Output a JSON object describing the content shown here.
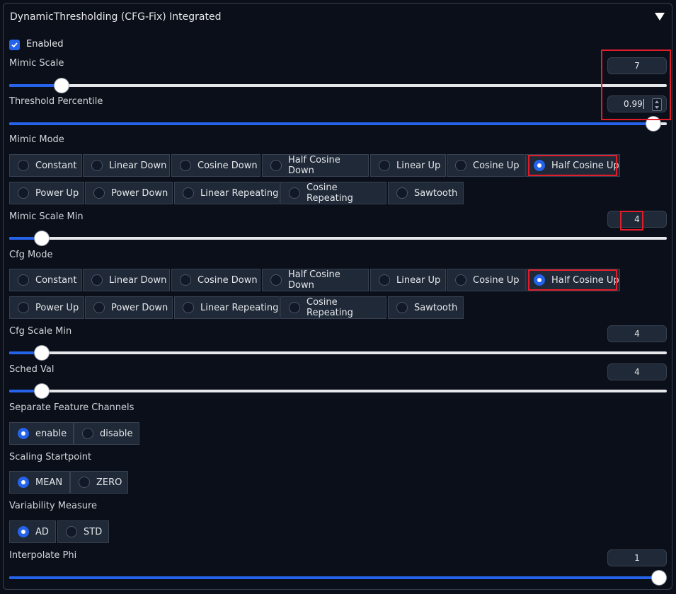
{
  "panel": {
    "title": "DynamicThresholding (CFG-Fix) Integrated",
    "enabled_label": "Enabled",
    "enabled": true
  },
  "mimic_scale": {
    "label": "Mimic Scale",
    "value": "7",
    "fraction": 0.08
  },
  "threshold_percentile": {
    "label": "Threshold Percentile",
    "value": "0.99",
    "fraction": 0.99
  },
  "mimic_mode": {
    "label": "Mimic Mode",
    "options": [
      "Constant",
      "Linear Down",
      "Cosine Down",
      "Half Cosine Down",
      "Linear Up",
      "Cosine Up",
      "Half Cosine Up",
      "Power Up",
      "Power Down",
      "Linear Repeating",
      "Cosine Repeating",
      "Sawtooth"
    ],
    "selected": "Half Cosine Up"
  },
  "mimic_scale_min": {
    "label": "Mimic Scale Min",
    "value": "4",
    "fraction": 0.05
  },
  "cfg_mode": {
    "label": "Cfg Mode",
    "options": [
      "Constant",
      "Linear Down",
      "Cosine Down",
      "Half Cosine Down",
      "Linear Up",
      "Cosine Up",
      "Half Cosine Up",
      "Power Up",
      "Power Down",
      "Linear Repeating",
      "Cosine Repeating",
      "Sawtooth"
    ],
    "selected": "Half Cosine Up"
  },
  "cfg_scale_min": {
    "label": "Cfg Scale Min",
    "value": "4",
    "fraction": 0.05
  },
  "sched_val": {
    "label": "Sched Val",
    "value": "4",
    "fraction": 0.05
  },
  "separate_feature_channels": {
    "label": "Separate Feature Channels",
    "options": [
      "enable",
      "disable"
    ],
    "selected": "enable"
  },
  "scaling_startpoint": {
    "label": "Scaling Startpoint",
    "options": [
      "MEAN",
      "ZERO"
    ],
    "selected": "MEAN"
  },
  "variability_measure": {
    "label": "Variability Measure",
    "options": [
      "AD",
      "STD"
    ],
    "selected": "AD"
  },
  "interpolate_phi": {
    "label": "Interpolate Phi",
    "value": "1",
    "fraction": 1.0
  },
  "colors": {
    "accent": "#2563eb",
    "highlight": "#e11d2a",
    "background": "#0b0f19"
  }
}
